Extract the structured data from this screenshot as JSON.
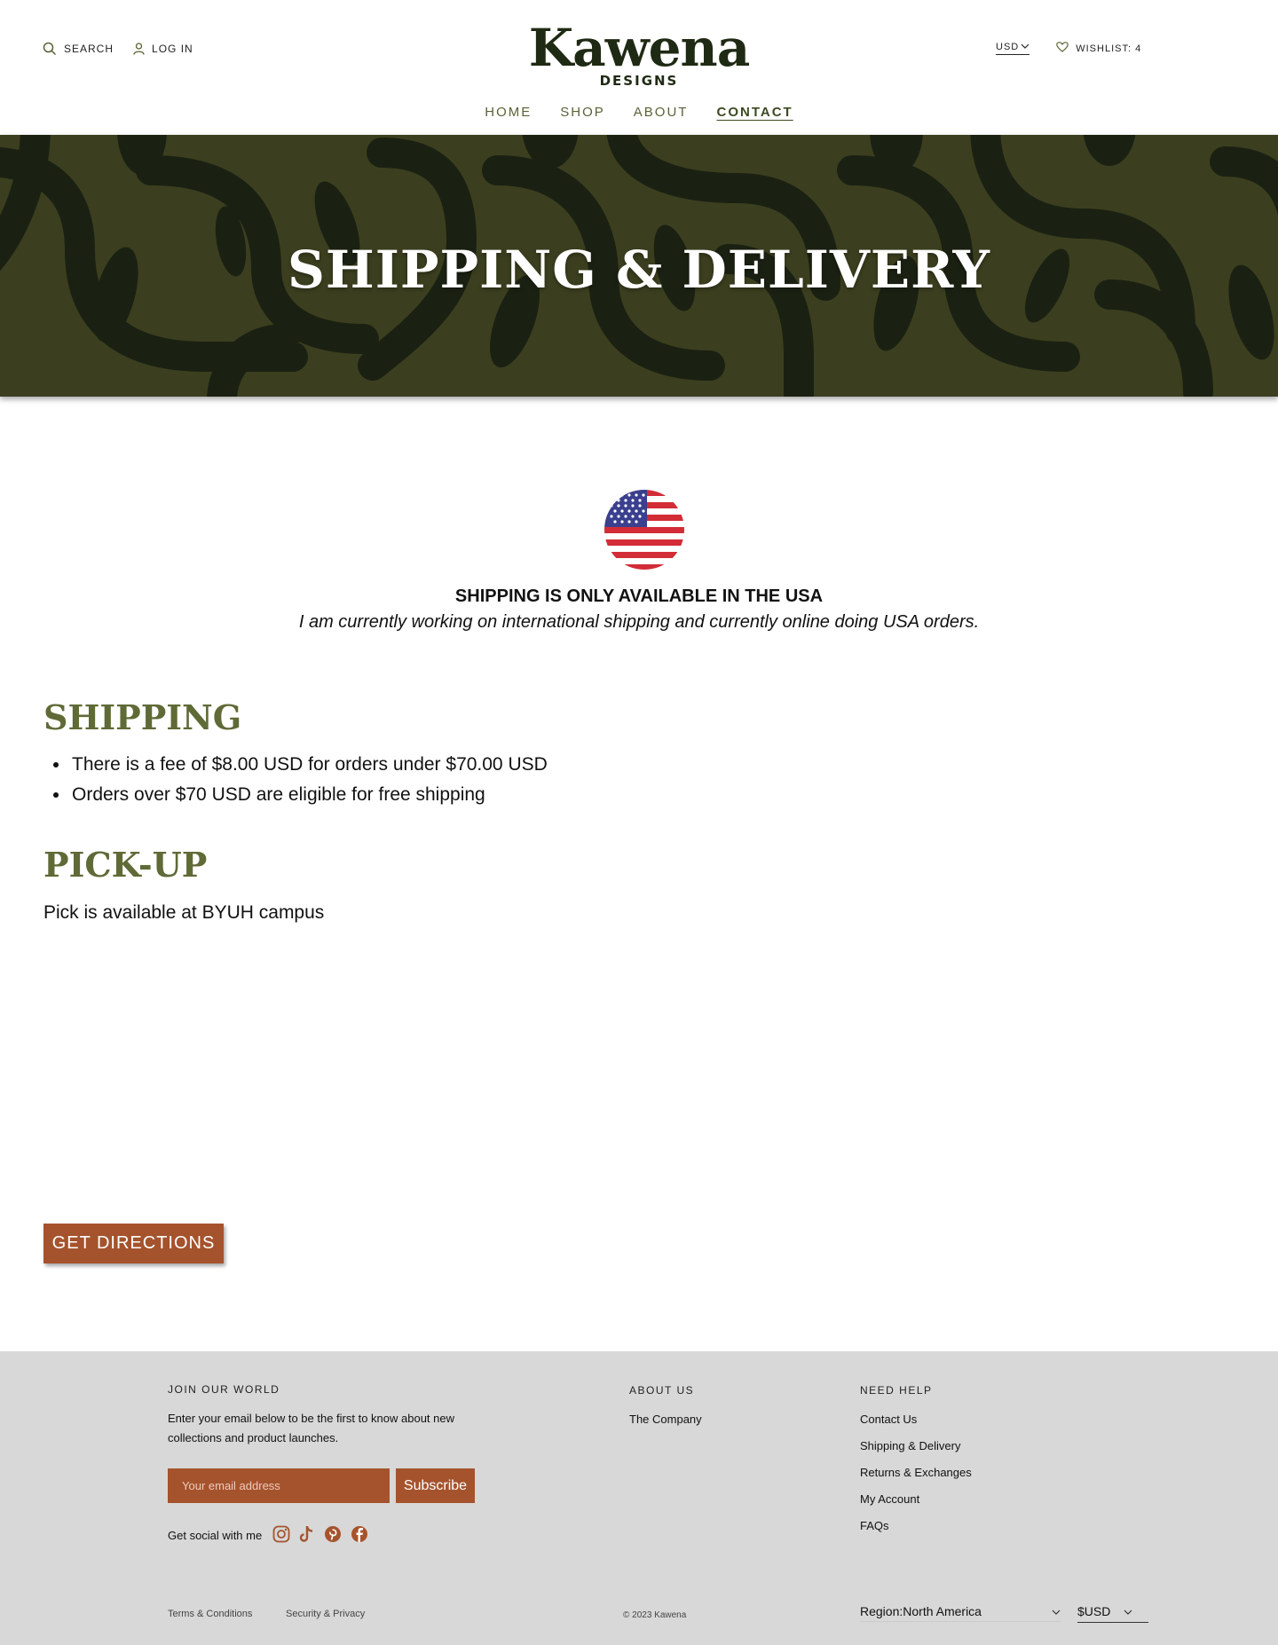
{
  "header": {
    "search_label": "SEARCH",
    "login_label": "LOG IN",
    "logo_word": "Kawena",
    "logo_sub": "DESIGNS",
    "currency": "USD",
    "wishlist_label": "WISHLIST: 4"
  },
  "nav": [
    {
      "label": "HOME"
    },
    {
      "label": "SHOP"
    },
    {
      "label": "ABOUT"
    },
    {
      "label": "CONTACT",
      "active": true
    }
  ],
  "hero": {
    "title": "SHIPPING & DELIVERY"
  },
  "notice": {
    "title": "SHIPPING IS ONLY AVAILABLE IN THE USA",
    "subtitle": "I am currently working on international shipping and currently online doing USA orders."
  },
  "shipping": {
    "heading": "SHIPPING",
    "bullets": [
      "There is a fee of $8.00 USD for orders under $70.00 USD",
      "Orders over $70 USD are eligible for free shipping"
    ]
  },
  "pickup": {
    "heading": "PICK-UP",
    "text": "Pick is available at BYUH campus",
    "button_label": "GET DIRECTIONS"
  },
  "footer": {
    "join": {
      "heading": "JOIN OUR WORLD",
      "text": "Enter your email below to be the first to know about new collections and product launches.",
      "email_placeholder": "Your email address",
      "subscribe_label": "Subscribe",
      "social_label": "Get social with me",
      "social_icons": [
        "instagram-icon",
        "tiktok-icon",
        "pinterest-icon",
        "facebook-icon"
      ]
    },
    "about": {
      "heading": "ABOUT US",
      "links": [
        "The Company"
      ]
    },
    "help": {
      "heading": "NEED HELP",
      "links": [
        "Contact Us",
        "Shipping & Delivery",
        "Returns & Exchanges",
        "My Account",
        "FAQs"
      ]
    },
    "bottom": {
      "terms": "Terms & Conditions",
      "privacy": "Security & Privacy",
      "copyright": "© 2023 Kawena",
      "region_label": "Region:",
      "region_value": "North America",
      "currency_value": "$USD"
    }
  },
  "colors": {
    "accent": "#a5532d",
    "olive": "#5f6a36",
    "hero_bg": "#3b3f1f",
    "hero_pattern": "#1b2112",
    "footer_bg": "#d8d8d8"
  }
}
